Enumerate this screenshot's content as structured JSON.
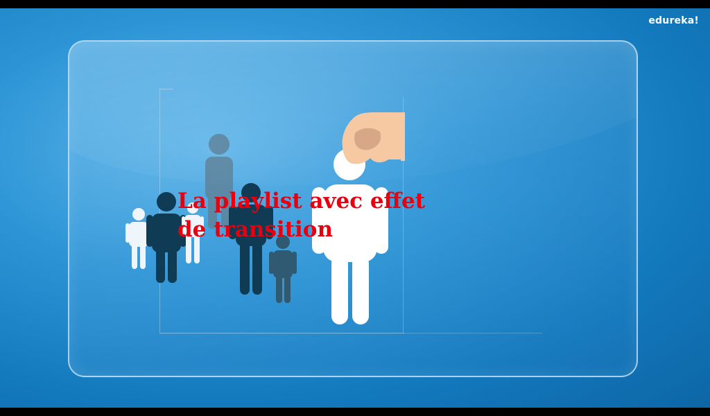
{
  "video": {
    "logo_text": "edureka!",
    "caption": "La playlist avec effet de transition"
  },
  "icons": {
    "logo": "edureka-logo",
    "hand": "hand-picking-person-icon",
    "people": "people-figures-icon"
  },
  "colors": {
    "background": "#1a82c6",
    "caption": "#e8000f",
    "figure_white": "#ffffff",
    "figure_dark": "#0e3a55"
  }
}
